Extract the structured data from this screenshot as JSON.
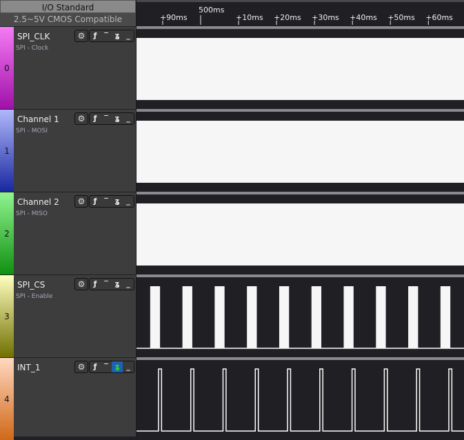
{
  "io_standard": {
    "title": "I/O Standard",
    "value": "2.5~5V CMOS Compatible"
  },
  "timeline": {
    "major_label": "500ms",
    "major_ms": 500,
    "tick_labels": [
      "+90ms",
      "+10ms",
      "+20ms",
      "+30ms",
      "+40ms",
      "+50ms",
      "+60ms"
    ],
    "tick_ms": [
      490,
      510,
      520,
      530,
      540,
      550,
      560
    ],
    "view_start_ms": 483.1,
    "view_end_ms": 569.4
  },
  "channels": [
    {
      "index": "0",
      "name": "SPI_CLK",
      "subtitle": "SPI - Clock",
      "color_top": "#f47cf4",
      "color_bottom": "#a010a8",
      "signal": "high",
      "trigger_selected": null
    },
    {
      "index": "1",
      "name": "Channel 1",
      "subtitle": "SPI - MOSI",
      "color_top": "#b0b8fa",
      "color_bottom": "#1828a0",
      "signal": "high",
      "trigger_selected": null
    },
    {
      "index": "2",
      "name": "Channel 2",
      "subtitle": "SPI - MISO",
      "color_top": "#90f490",
      "color_bottom": "#109010",
      "signal": "high",
      "trigger_selected": null
    },
    {
      "index": "3",
      "name": "SPI_CS",
      "subtitle": "SPI - Enable",
      "color_top": "#ffffc0",
      "color_bottom": "#707000",
      "signal": "pulses",
      "first_rise_ms": 486.7,
      "period_ms": 8.5,
      "pulse_width_ms": 2.6,
      "trigger_selected": null
    },
    {
      "index": "4",
      "name": "INT_1",
      "subtitle": "",
      "color_top": "#ffd8c0",
      "color_bottom": "#d06818",
      "signal": "pulses",
      "first_rise_ms": 488.9,
      "period_ms": 8.5,
      "pulse_width_ms": 0.8,
      "trigger_selected": "falling-edge"
    }
  ],
  "trigger_icons": [
    "rising-edge",
    "high-level",
    "falling-edge",
    "low-level"
  ],
  "trigger_glyphs": [
    "⎱",
    "‾",
    "⊥",
    "_"
  ],
  "gear_glyph": "⚙"
}
